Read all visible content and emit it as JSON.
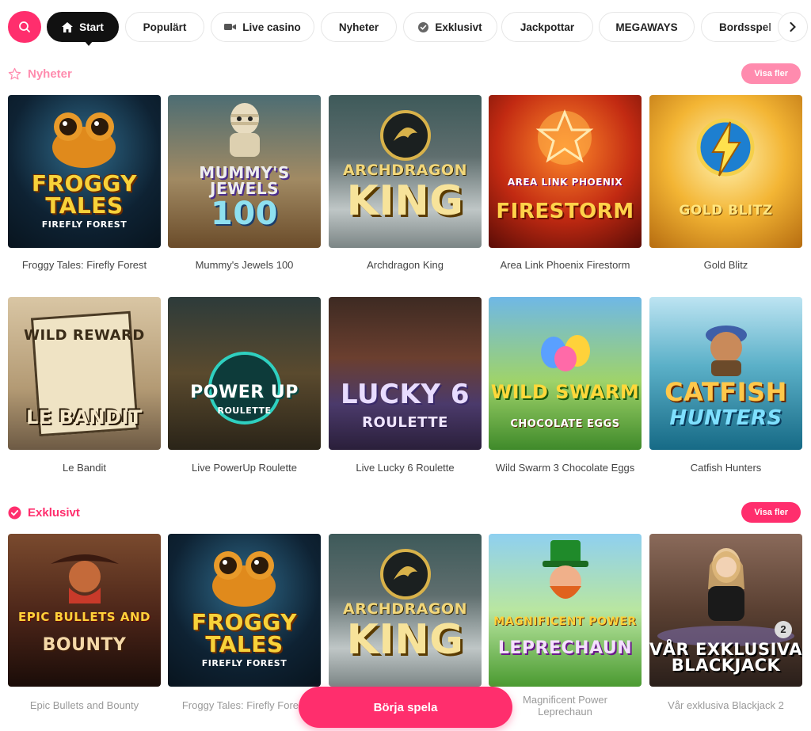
{
  "nav": {
    "search_label": "Sök",
    "tabs": [
      {
        "label": "Start",
        "icon": "home-icon"
      },
      {
        "label": "Populärt",
        "icon": ""
      },
      {
        "label": "Live casino",
        "icon": "camera-icon"
      },
      {
        "label": "Nyheter",
        "icon": ""
      },
      {
        "label": "Exklusivt",
        "icon": "check-circle-icon"
      },
      {
        "label": "Jackpottar",
        "icon": ""
      },
      {
        "label": "MEGAWAYS",
        "icon": ""
      },
      {
        "label": "Bordsspel",
        "icon": ""
      }
    ]
  },
  "sections": {
    "nyheter": {
      "title": "Nyheter",
      "icon": "star-icon",
      "more": "Visa fler",
      "games": [
        {
          "name": "Froggy Tales: Firefly Forest",
          "logo": "FROGGY TALES",
          "sub": "FIREFLY FOREST"
        },
        {
          "name": "Mummy's Jewels 100",
          "logo": "MUMMY'S JEWELS",
          "sub": "100"
        },
        {
          "name": "Archdragon King",
          "logo": "ARCHDRAGON",
          "sub": "KING"
        },
        {
          "name": "Area Link Phoenix Firestorm",
          "logo": "AREA LINK PHOENIX",
          "sub": "FIRESTORM"
        },
        {
          "name": "Gold Blitz",
          "logo": "GOLD BLITZ",
          "sub": ""
        },
        {
          "name": "Le Bandit",
          "logo": "WILD REWARD",
          "sub": "LE BANDIT"
        },
        {
          "name": "Live PowerUp Roulette",
          "logo": "POWER UP",
          "sub": "ROULETTE"
        },
        {
          "name": "Live Lucky 6 Roulette",
          "logo": "LUCKY 6",
          "sub": "ROULETTE"
        },
        {
          "name": "Wild Swarm 3 Chocolate Eggs",
          "logo": "WILD SWARM",
          "sub": "CHOCOLATE EGGS"
        },
        {
          "name": "Catfish Hunters",
          "logo": "CATFISH",
          "sub": "HUNTERS"
        }
      ]
    },
    "exklusivt": {
      "title": "Exklusivt",
      "icon": "check-circle-icon",
      "more": "Visa fler",
      "games": [
        {
          "name": "Epic Bullets and Bounty",
          "logo": "EPIC BULLETS AND",
          "sub": "BOUNTY"
        },
        {
          "name": "Froggy Tales: Firefly Forest",
          "logo": "FROGGY TALES",
          "sub": "FIREFLY FOREST"
        },
        {
          "name": "Archdragon King",
          "logo": "ARCHDRAGON",
          "sub": "KING"
        },
        {
          "name": "Magnificent Power Leprechaun",
          "logo": "MAGNIFICENT POWER",
          "sub": "LEPRECHAUN"
        },
        {
          "name": "Vår exklusiva Blackjack 2",
          "logo": "VÅR EXKLUSIVA",
          "sub": "BLACKJACK"
        }
      ]
    }
  },
  "cta": {
    "label": "Börja spela"
  },
  "colors": {
    "accent": "#ff2e6d",
    "nyheter_title": "#ff8fb0",
    "exklusivt_title": "#ff2e6d"
  }
}
